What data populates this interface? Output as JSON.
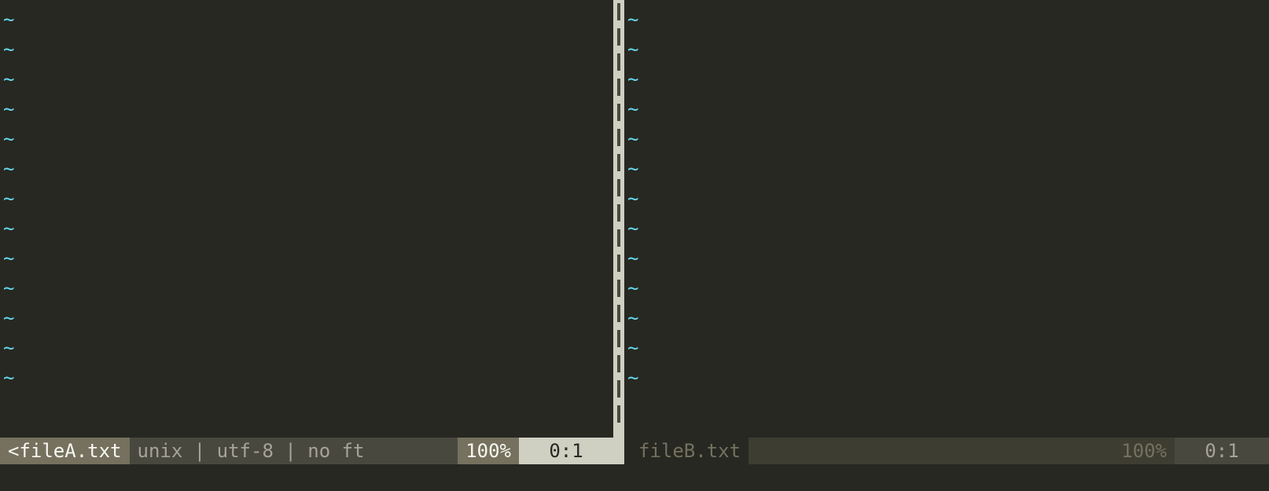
{
  "left": {
    "filename": "<fileA.txt",
    "fileinfo": "unix | utf-8 | no ft",
    "percent": "100%",
    "linecol": "0:1",
    "tilde": "~",
    "tilde_rows": 13
  },
  "right": {
    "filename": "fileB.txt",
    "fileinfo": "",
    "percent": "100%",
    "linecol": "0:1",
    "tilde": "~",
    "tilde_rows": 13
  },
  "split_dashes": 17
}
